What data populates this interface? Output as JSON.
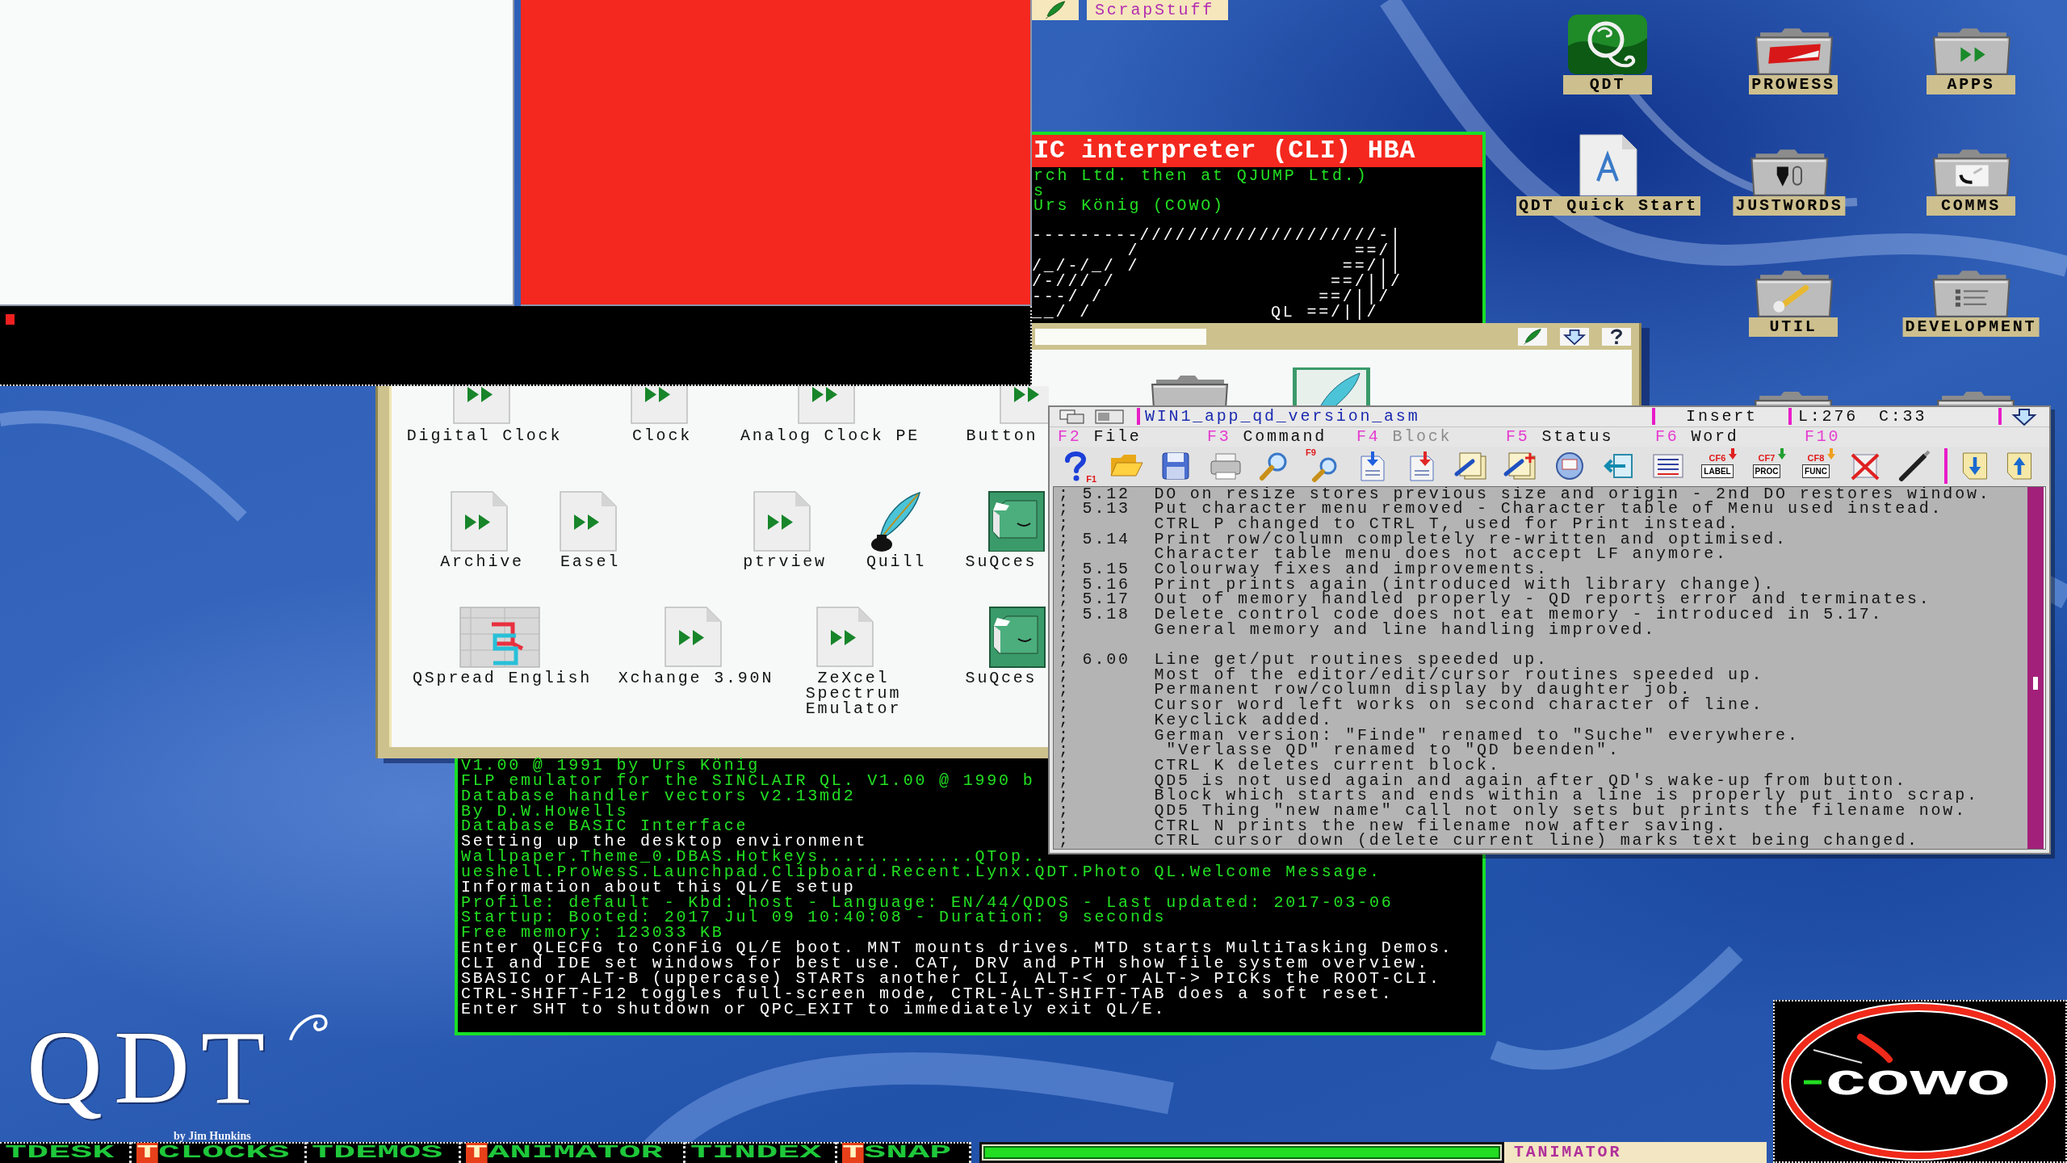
{
  "scrap_tab": {
    "label": "ScrapStuff"
  },
  "console": {
    "title": "IC interpreter (CLI) HBA",
    "credits": [
      {
        "text": "rch Ltd. then at QJUMP Ltd.)",
        "color": "#22e022"
      },
      {
        "text": "s",
        "color": "#22e022"
      },
      {
        "text": "Urs König (COWO)",
        "color": "#22e022"
      }
    ],
    "banner_art": [
      "---------////////////////////-|",
      "        /                  ==/|",
      "/_/-/_/ /                 ==/||",
      "/-/// /                  ==/||/",
      "---/ /                  ==/||/",
      "__/ /               QL ==/||/"
    ],
    "output": [
      {
        "text": "V1.00 @ 1991 by Urs König",
        "color": "#22e022"
      },
      {
        "text": "FLP emulator for the SINCLAIR QL. V1.00 @ 1990 b",
        "color": "#22e022"
      },
      {
        "text": "Database handler vectors v2.13md2",
        "color": "#22e022"
      },
      {
        "text": "By D.W.Howells",
        "color": "#22e022"
      },
      {
        "text": "Database BASIC Interface",
        "color": "#22e022"
      },
      {
        "text": "Setting up the desktop environment",
        "color": "#ffffff"
      },
      {
        "text": "Wallpaper.Theme_0.DBAS.Hotkeys.............QTop..",
        "color": "#22e022"
      },
      {
        "text": "ueshell.ProWesS.Launchpad.Clipboard.Recent.Lynx.QDT.Photo QL.Welcome Message.",
        "color": "#22e022"
      },
      {
        "text": "Information about this QL/E setup",
        "color": "#ffffff"
      },
      {
        "text": "Profile: default - Kbd: host - Language: EN/44/QDOS - Last updated: 2017-03-06",
        "color": "#22e022"
      },
      {
        "text": "Startup: Booted: 2017 Jul 09 10:40:08 - Duration: 9 seconds",
        "color": "#22e022"
      },
      {
        "text": "Free memory: 123033 KB",
        "color": "#22e022"
      },
      {
        "text": "Enter QLECFG to ConFiG QL/E boot. MNT mounts drives. MTD starts MultiTasking Demos.",
        "color": "#ffffff"
      },
      {
        "text": "CLI and IDE set windows for best use. CAT, DRV and PTH show file system overview.",
        "color": "#ffffff"
      },
      {
        "text": "SBASIC or ALT-B (uppercase) STARTs another CLI, ALT-< or ALT-> PICKs the ROOT-CLI.",
        "color": "#ffffff"
      },
      {
        "text": "CTRL-SHIFT-F12 toggles full-screen mode, CTRL-ALT-SHIFT-TAB does a soft reset.",
        "color": "#ffffff"
      },
      {
        "text": "Enter SHT to shutdown or QPC_EXIT to immediately exit QL/E.",
        "color": "#ffffff"
      }
    ]
  },
  "file_window": {
    "icons": [
      {
        "kind": "program",
        "label": "Digital Clock"
      },
      {
        "kind": "program",
        "label": "Clock"
      },
      {
        "kind": "program",
        "label": "Analog Clock PE"
      },
      {
        "kind": "program",
        "label": "Button"
      },
      {
        "kind": "folder"
      },
      {
        "kind": "quill-tile"
      },
      {
        "kind": "program",
        "label": "Archive"
      },
      {
        "kind": "program",
        "label": "Easel"
      },
      {
        "kind": "program",
        "label": "ptrview"
      },
      {
        "kind": "quill",
        "label": "Quill"
      },
      {
        "kind": "database",
        "label": "SuQces"
      },
      {
        "kind": "spreadsheet",
        "label": "QSpread English"
      },
      {
        "kind": "program",
        "label": "Xchange 3.90N"
      },
      {
        "kind": "program",
        "label": "ZeXcel Spectrum Emulator"
      },
      {
        "kind": "database",
        "label": "SuQces"
      }
    ]
  },
  "desktop_icons": [
    {
      "label": "QDT",
      "kind": "tile"
    },
    {
      "label": "PROWESS",
      "kind": "banner"
    },
    {
      "label": "APPS",
      "kind": "arrows"
    },
    {
      "label": "QDT Quick Start",
      "kind": "document"
    },
    {
      "label": "JUSTWORDS",
      "kind": "pen"
    },
    {
      "label": "COMMS",
      "kind": "phone"
    },
    {
      "label": "UTIL",
      "kind": "wrench"
    },
    {
      "label": "DEVELOPMENT",
      "kind": "list"
    }
  ],
  "editor": {
    "title": "WIN1_app_qd_version_asm",
    "mode": "Insert",
    "line": "L:276",
    "column": "C:33",
    "menu": [
      {
        "key": "F2",
        "label": "File",
        "disabled": false
      },
      {
        "key": "F3",
        "label": "Command",
        "disabled": false
      },
      {
        "key": "F4",
        "label": "Block",
        "disabled": true
      },
      {
        "key": "F5",
        "label": "Status",
        "disabled": false
      },
      {
        "key": "F6",
        "label": "Word",
        "disabled": false
      },
      {
        "key": "F10"
      }
    ],
    "tools": [
      {
        "kind": "help",
        "key": "F1"
      },
      {
        "kind": "open"
      },
      {
        "kind": "save"
      },
      {
        "kind": "print"
      },
      {
        "kind": "find"
      },
      {
        "kind": "find-next",
        "key": "F9"
      },
      {
        "kind": "import"
      },
      {
        "kind": "export"
      },
      {
        "kind": "copy"
      },
      {
        "kind": "paste"
      },
      {
        "kind": "disk"
      },
      {
        "kind": "back"
      },
      {
        "kind": "lines"
      },
      {
        "kind": "tag",
        "key": "CF6",
        "caption": "LABEL",
        "color": "#e02020"
      },
      {
        "kind": "tag",
        "key": "CF7",
        "caption": "PROC",
        "color": "#20a030"
      },
      {
        "kind": "tag",
        "key": "CF8",
        "caption": "FUNC",
        "color": "#f0a020"
      },
      {
        "kind": "no-tab"
      },
      {
        "kind": "pen"
      },
      {
        "kind": "separator"
      },
      {
        "kind": "page-down"
      },
      {
        "kind": "page-up"
      }
    ],
    "lines": [
      "; 5.12  DO on resize stores previous size and origin - 2nd DO restores window.",
      "; 5.13  Put character menu removed - Character table of Menu used instead.",
      ";       CTRL P changed to CTRL T, used for Print instead.",
      "; 5.14  Print row/column completely re-written and optimised.",
      ";       Character table menu does not accept LF anymore.",
      "; 5.15  Colourway fixes and improvements.",
      "; 5.16  Print prints again (introduced with library change).",
      "; 5.17  Out of memory handled properly - QD reports error and terminates.",
      "; 5.18  Delete control code does not eat memory - introduced in 5.17.",
      ";       General memory and line handling improved.",
      ";",
      "; 6.00  Line get/put routines speeded up.",
      ";       Most of the editor/edit/cursor routines speeded up.",
      ";       Permanent row/column display by daughter job.",
      ";       Cursor word left works on second character of line.",
      ";       Keyclick added.",
      ";       German version: \"Finde\" renamed to \"Suche\" everywhere.",
      ";        \"Verlasse QD\" renamed to \"QD beenden\".",
      ";       CTRL K deletes current block.",
      ";       QD5 is not used again and again after QD's wake-up from button.",
      ";       Block which starts and ends within a line is properly put into scrap.",
      ";       QD5 Thing \"new name\" call not only sets but prints the filename now.",
      ";       CTRL N prints the new filename now after saving.",
      ";       CTRL cursor down (delete current line) marks text being changed."
    ]
  },
  "qdt_logo": {
    "text": "QDT",
    "byline": "by Jim Hunkins"
  },
  "cowo_logo": {
    "text": "cowo"
  },
  "taskbar": {
    "buttons": [
      {
        "prefix": "T",
        "label": "DESK",
        "active": false
      },
      {
        "prefix": "T",
        "label": "CLOCKS",
        "active": true
      },
      {
        "prefix": "T",
        "label": "DEMOS",
        "active": false
      },
      {
        "prefix": "T",
        "label": "ANIMATOR",
        "active": true
      },
      {
        "prefix": "T",
        "label": "INDEX",
        "active": false
      },
      {
        "prefix": "T",
        "label": "SNAP",
        "active": true
      }
    ],
    "meter": {
      "level": 1
    },
    "task": "TANIMATOR"
  }
}
